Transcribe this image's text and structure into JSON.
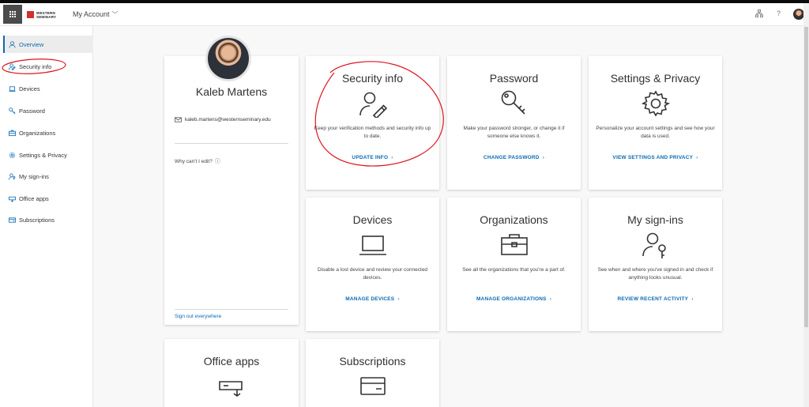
{
  "header": {
    "logo_text": "WESTERN SEMINARY",
    "app_title": "My Account",
    "org_icon": "org-chart-icon",
    "help_glyph": "?"
  },
  "sidebar": {
    "items": [
      {
        "label": "Overview",
        "icon": "person-icon"
      },
      {
        "label": "Security info",
        "icon": "person-edit-icon"
      },
      {
        "label": "Devices",
        "icon": "laptop-icon"
      },
      {
        "label": "Password",
        "icon": "key-icon"
      },
      {
        "label": "Organizations",
        "icon": "briefcase-icon"
      },
      {
        "label": "Settings & Privacy",
        "icon": "gear-icon"
      },
      {
        "label": "My sign-ins",
        "icon": "person-key-icon"
      },
      {
        "label": "Office apps",
        "icon": "office-apps-icon"
      },
      {
        "label": "Subscriptions",
        "icon": "card-icon"
      }
    ]
  },
  "profile": {
    "name": "Kaleb Martens",
    "email": "kaleb.martens@westernseminary.edu",
    "why_cant_edit": "Why can't I edit?",
    "info_glyph": "ⓘ",
    "sign_out": "Sign out everywhere"
  },
  "cards": {
    "security": {
      "title": "Security info",
      "desc": "Keep your verification methods and security info up to date.",
      "link": "UPDATE INFO"
    },
    "password": {
      "title": "Password",
      "desc": "Make your password stronger, or change it if someone else knows it.",
      "link": "CHANGE PASSWORD"
    },
    "settings": {
      "title": "Settings & Privacy",
      "desc": "Personalize your account settings and see how your data is used.",
      "link": "VIEW SETTINGS AND PRIVACY"
    },
    "devices": {
      "title": "Devices",
      "desc": "Disable a lost device and review your connected devices.",
      "link": "MANAGE DEVICES"
    },
    "organizations": {
      "title": "Organizations",
      "desc": "See all the organizations that you're a part of.",
      "link": "MANAGE ORGANIZATIONS"
    },
    "signins": {
      "title": "My sign-ins",
      "desc": "See when and where you've signed in and check if anything looks unusual.",
      "link": "REVIEW RECENT ACTIVITY"
    },
    "officeapps": {
      "title": "Office apps"
    },
    "subscriptions": {
      "title": "Subscriptions"
    }
  },
  "link_chevron": "›",
  "colors": {
    "accent": "#0a6ab4",
    "annotation": "#e0141e",
    "logo_red": "#d0312d"
  }
}
